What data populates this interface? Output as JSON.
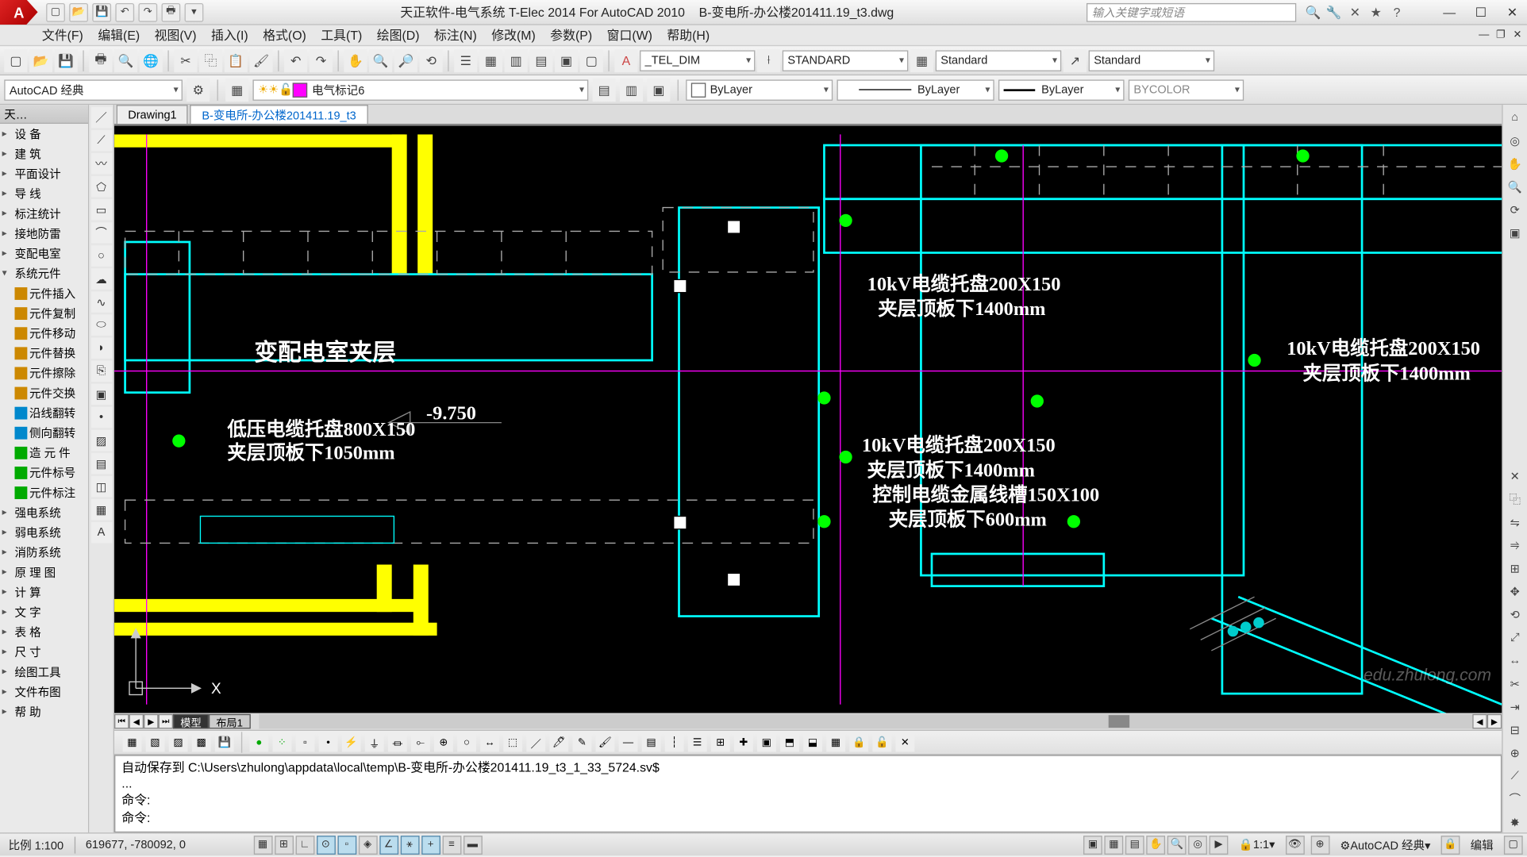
{
  "title": {
    "app": "天正软件-电气系统 T-Elec 2014  For AutoCAD 2010",
    "file": "B-变电所-办公楼201411.19_t3.dwg",
    "search_placeholder": "输入关键字或短语"
  },
  "menus": [
    "文件(F)",
    "编辑(E)",
    "视图(V)",
    "插入(I)",
    "格式(O)",
    "工具(T)",
    "绘图(D)",
    "标注(N)",
    "修改(M)",
    "参数(P)",
    "窗口(W)",
    "帮助(H)"
  ],
  "toolbar1": {
    "textstyle": "_TEL_DIM",
    "dimstyle": "STANDARD",
    "tablestyle": "Standard",
    "mleaderstyle": "Standard"
  },
  "toolbar2": {
    "workspace": "AutoCAD 经典",
    "layer": "电气标记6",
    "color": "ByLayer",
    "linetype": "ByLayer",
    "lineweight": "ByLayer",
    "plotstyle": "BYCOLOR"
  },
  "palette": {
    "title": "天…",
    "items": [
      {
        "label": "设     备",
        "expand": "▸"
      },
      {
        "label": "建     筑",
        "expand": "▸"
      },
      {
        "label": "平面设计",
        "expand": "▸"
      },
      {
        "label": "导     线",
        "expand": "▸"
      },
      {
        "label": "标注统计",
        "expand": "▸"
      },
      {
        "label": "接地防雷",
        "expand": "▸"
      },
      {
        "label": "变配电室",
        "expand": "▸"
      },
      {
        "label": "系统元件",
        "expand": "▾"
      },
      {
        "label": "元件插入",
        "expand": "",
        "icon": "#c80"
      },
      {
        "label": "元件复制",
        "expand": "",
        "icon": "#c80"
      },
      {
        "label": "元件移动",
        "expand": "",
        "icon": "#c80"
      },
      {
        "label": "元件替换",
        "expand": "",
        "icon": "#c80"
      },
      {
        "label": "元件擦除",
        "expand": "",
        "icon": "#c80"
      },
      {
        "label": "元件交换",
        "expand": "",
        "icon": "#c80"
      },
      {
        "label": "沿线翻转",
        "expand": "",
        "icon": "#08c"
      },
      {
        "label": "侧向翻转",
        "expand": "",
        "icon": "#08c"
      },
      {
        "label": "造 元 件",
        "expand": "",
        "icon": "#0a0"
      },
      {
        "label": "元件标号",
        "expand": "",
        "icon": "#0a0"
      },
      {
        "label": "元件标注",
        "expand": "",
        "icon": "#0a0"
      },
      {
        "label": "强电系统",
        "expand": "▸"
      },
      {
        "label": "弱电系统",
        "expand": "▸"
      },
      {
        "label": "消防系统",
        "expand": "▸"
      },
      {
        "label": "原 理 图",
        "expand": "▸"
      },
      {
        "label": "计     算",
        "expand": "▸"
      },
      {
        "label": "文     字",
        "expand": "▸"
      },
      {
        "label": "表     格",
        "expand": "▸"
      },
      {
        "label": "尺     寸",
        "expand": "▸"
      },
      {
        "label": "绘图工具",
        "expand": "▸"
      },
      {
        "label": "文件布图",
        "expand": "▸"
      },
      {
        "label": "帮     助",
        "expand": "▸"
      }
    ]
  },
  "doc_tabs": [
    {
      "label": "Drawing1",
      "active": false
    },
    {
      "label": "B-变电所-办公楼201411.19_t3",
      "active": true
    }
  ],
  "layout_tabs": [
    "模型",
    "布局1"
  ],
  "drawing_labels": {
    "room": "变配电室夹层",
    "elev": "-9.750",
    "lv1": "低压电缆托盘800X150",
    "lv2": "夹层顶板下1050mm",
    "hv1a": "10kV电缆托盘200X150",
    "hv1b": "夹层顶板下1400mm",
    "hv2a": "10kV电缆托盘200X150",
    "hv2b": "夹层顶板下1400mm",
    "hv2c": "控制电缆金属线槽150X100",
    "hv2d": "夹层顶板下600mm",
    "hv3a": "10kV电缆托盘200X150",
    "hv3b": "夹层顶板下1400mm",
    "x_axis": "X"
  },
  "cmdline": {
    "l1": "自动保存到  C:\\Users\\zhulong\\appdata\\local\\temp\\B-变电所-办公楼201411.19_t3_1_33_5724.sv$",
    "l2": "...",
    "l3": "命令:",
    "l4": "命令:"
  },
  "status": {
    "scale": "比例 1:100",
    "coords": "619677, -780092, 0",
    "annoscale": "1:1",
    "ws_label": "AutoCAD 经典",
    "tray": "编辑",
    "watermark": "edu.zhulong.com"
  }
}
